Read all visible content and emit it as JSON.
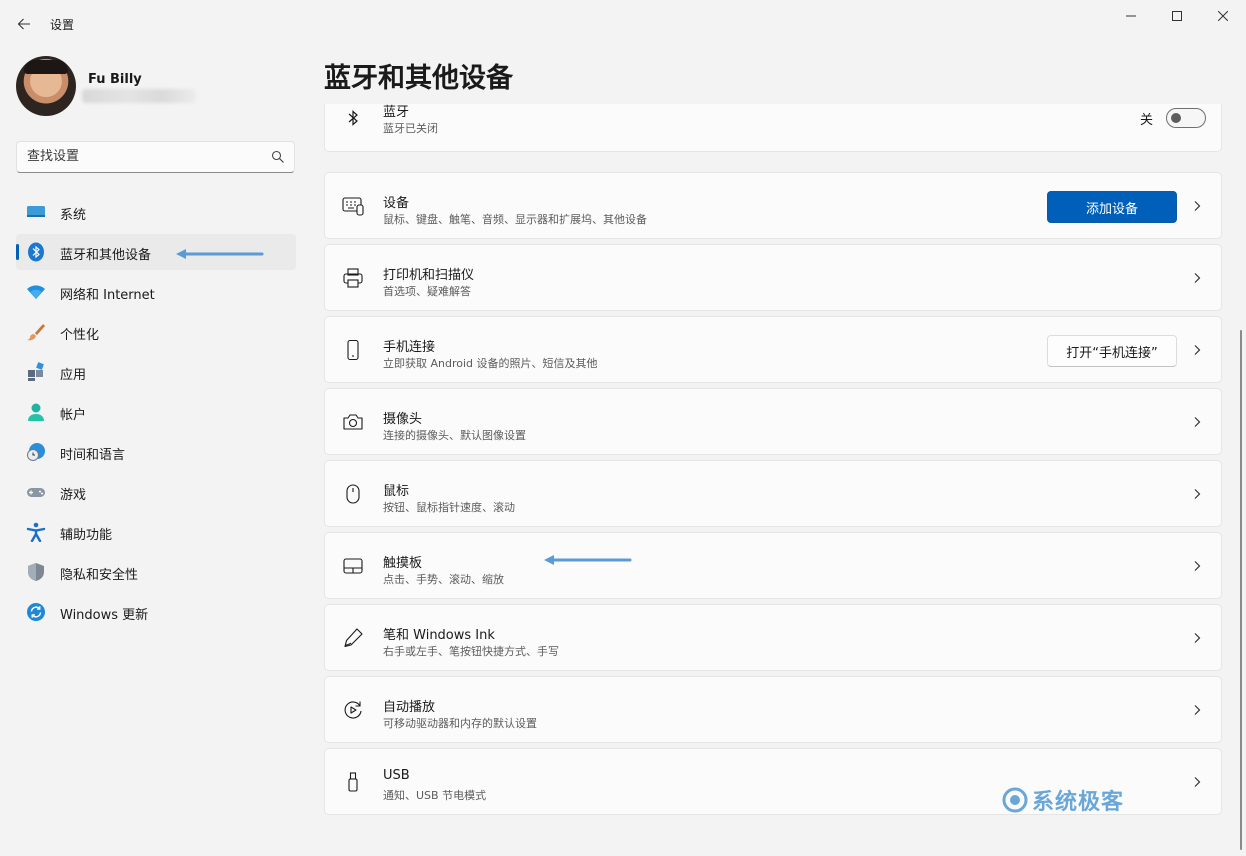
{
  "window": {
    "title": "设置"
  },
  "user": {
    "name": "Fu Billy"
  },
  "search": {
    "placeholder": "查找设置"
  },
  "sidebar": {
    "items": [
      {
        "label": "系统",
        "icon": "system-icon"
      },
      {
        "label": "蓝牙和其他设备",
        "icon": "bluetooth-icon",
        "selected": true
      },
      {
        "label": "网络和 Internet",
        "icon": "wifi-icon"
      },
      {
        "label": "个性化",
        "icon": "brush-icon"
      },
      {
        "label": "应用",
        "icon": "apps-icon"
      },
      {
        "label": "帐户",
        "icon": "account-icon"
      },
      {
        "label": "时间和语言",
        "icon": "globe-clock-icon"
      },
      {
        "label": "游戏",
        "icon": "gamepad-icon"
      },
      {
        "label": "辅助功能",
        "icon": "accessibility-icon"
      },
      {
        "label": "隐私和安全性",
        "icon": "shield-icon"
      },
      {
        "label": "Windows 更新",
        "icon": "update-icon"
      }
    ]
  },
  "page": {
    "title": "蓝牙和其他设备"
  },
  "bluetooth": {
    "title": "蓝牙",
    "subtitle": "蓝牙已关闭",
    "toggle_label": "关",
    "toggle_on": false
  },
  "cards": [
    {
      "title": "设备",
      "subtitle": "鼠标、键盘、触笔、音频、显示器和扩展坞、其他设备",
      "button": "添加设备",
      "icon": "devices-icon"
    },
    {
      "title": "打印机和扫描仪",
      "subtitle": "首选项、疑难解答",
      "icon": "printer-icon"
    },
    {
      "title": "手机连接",
      "subtitle": "立即获取 Android 设备的照片、短信及其他",
      "button": "打开“手机连接”",
      "icon": "phone-icon"
    },
    {
      "title": "摄像头",
      "subtitle": "连接的摄像头、默认图像设置",
      "icon": "camera-icon"
    },
    {
      "title": "鼠标",
      "subtitle": "按钮、鼠标指针速度、滚动",
      "icon": "mouse-icon"
    },
    {
      "title": "触摸板",
      "subtitle": "点击、手势、滚动、缩放",
      "icon": "touchpad-icon"
    },
    {
      "title": "笔和 Windows Ink",
      "subtitle": "右手或左手、笔按钮快捷方式、手写",
      "icon": "pen-icon"
    },
    {
      "title": "自动播放",
      "subtitle": "可移动驱动器和内存的默认设置",
      "icon": "autoplay-icon"
    },
    {
      "title": "USB",
      "subtitle": "通知、USB 节电模式",
      "icon": "usb-icon"
    }
  ],
  "watermark": {
    "text": "系统极客"
  },
  "colors": {
    "accent": "#005fb8",
    "background": "#f3f3f3",
    "card": "#fbfbfb",
    "annotation_arrow": "#5b9bd5"
  }
}
